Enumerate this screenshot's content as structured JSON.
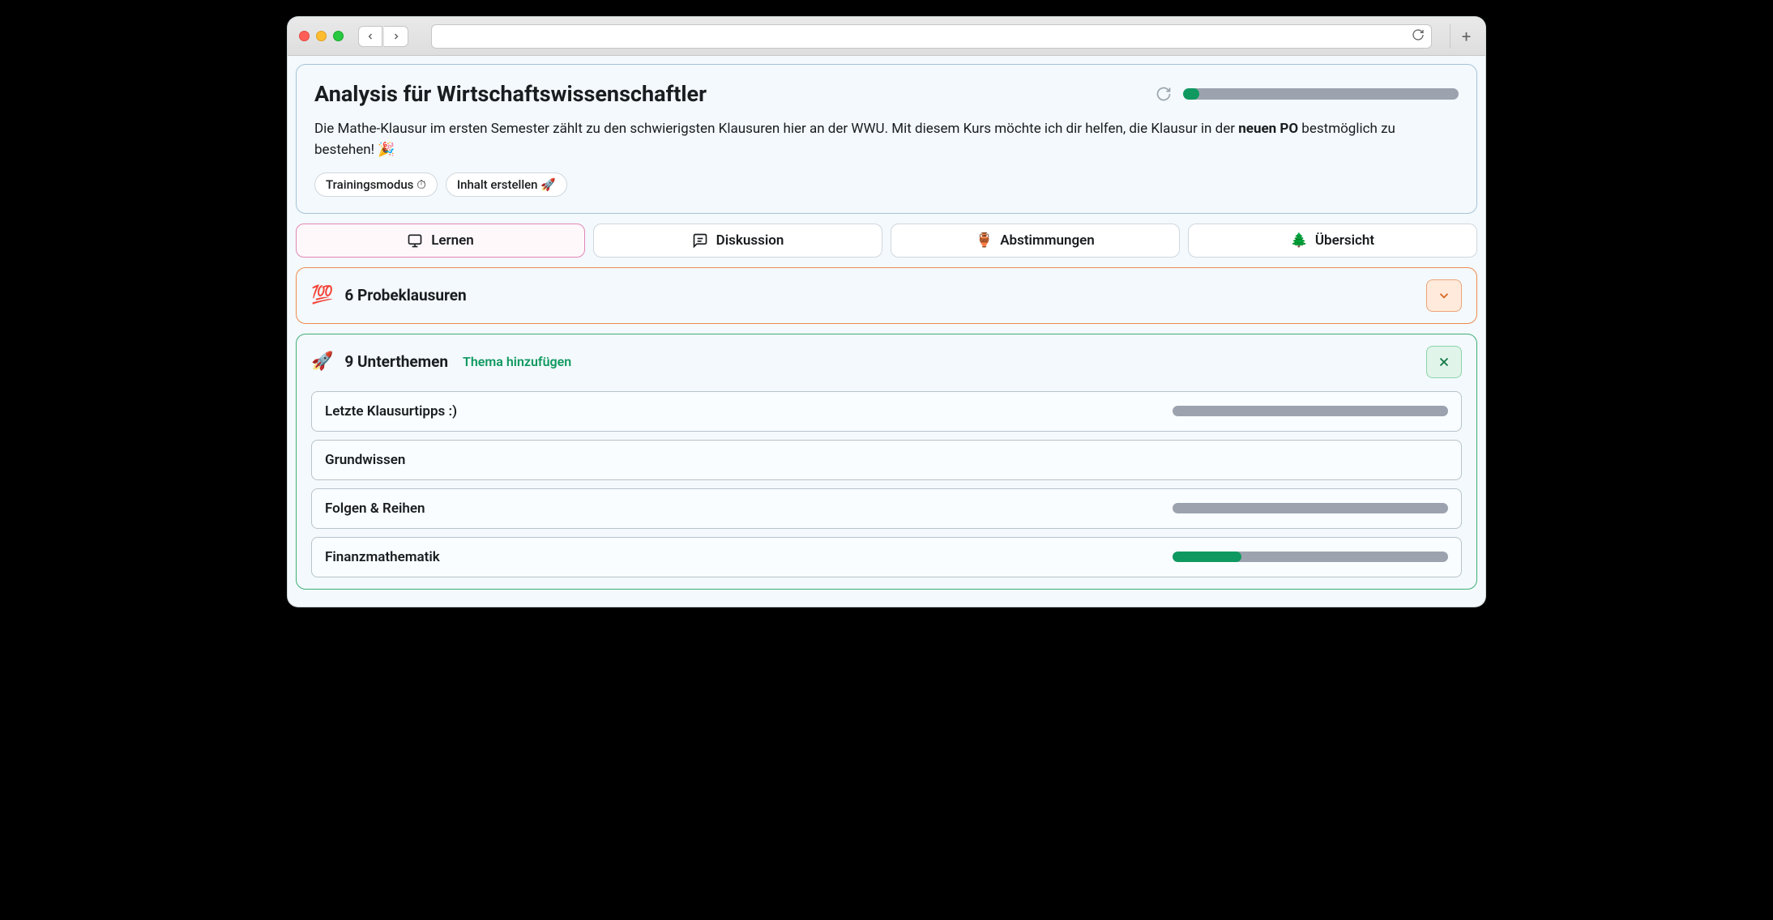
{
  "header": {
    "title": "Analysis für Wirtschaftswissenschaftler",
    "description_pre": "Die Mathe-Klausur im ersten Semester zählt zu den schwierigsten Klausuren hier an der WWU. Mit diesem Kurs möchte ich dir helfen, die Klausur in der ",
    "description_bold": "neuen PO",
    "description_post": " bestmöglich zu bestehen! 🎉",
    "overall_progress_percent": 6
  },
  "chips": {
    "training_mode": "Trainingsmodus ⏱",
    "create_content": "Inhalt erstellen 🚀"
  },
  "tabs": {
    "learn": "Lernen",
    "discussion": "Diskussion",
    "polls": "Abstimmungen",
    "overview": "Übersicht"
  },
  "practice_panel": {
    "emoji": "💯",
    "title": "6 Probeklausuren"
  },
  "subtopics_panel": {
    "emoji": "🚀",
    "title": "9 Unterthemen",
    "add_link": "Thema hinzufügen",
    "items": [
      {
        "title": "Letzte Klausurtipps :)",
        "progress": 0,
        "show_progress": true
      },
      {
        "title": "Grundwissen",
        "progress": 0,
        "show_progress": false
      },
      {
        "title": "Folgen & Reihen",
        "progress": 0,
        "show_progress": true
      },
      {
        "title": "Finanzmathematik",
        "progress": 25,
        "show_progress": true
      }
    ]
  }
}
